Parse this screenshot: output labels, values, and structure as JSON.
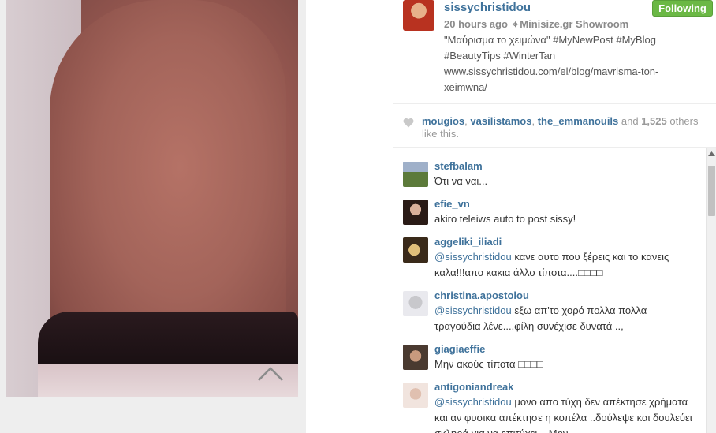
{
  "post": {
    "username": "sissychristidou",
    "follow_label": "Following",
    "time_ago": "20 hours ago",
    "location": "Minisize.gr Showroom",
    "caption_lines": [
      "\"Μαύρισμα το χειμώνα\" #MyNewPost #MyBlog",
      "#BeautyTips #WinterTan",
      "www.sissychristidou.com/el/blog/mavrisma-ton-",
      "xeimwna/"
    ],
    "colors": {
      "accent": "#3f729b",
      "follow_green": "#6bb845"
    }
  },
  "likes": {
    "user1": "mougios",
    "sep1": ", ",
    "user2": "vasilistamos",
    "sep2": ", ",
    "user3": "the_emmanouils",
    "and": " and ",
    "count": "1,525",
    "others": " others",
    "like_this": "like this."
  },
  "comments": [
    {
      "user": "stefbalam",
      "mention": "",
      "text": "Ότι να ναι..."
    },
    {
      "user": "efie_vn",
      "mention": "",
      "text": "akiro teleiws auto to post sissy!"
    },
    {
      "user": "aggeliki_iliadi",
      "mention": "@sissychristidou",
      "text": " κανε αυτο που ξέρεις και το κανεις καλα!!!απο κακια άλλο τίποτα....□□□□"
    },
    {
      "user": "christina.apostolou",
      "mention": "@sissychristidou",
      "text": " εξω απ'το χορό πολλα πολλα τραγούδια λένε....φίλη συνέχισε δυνατά ..,"
    },
    {
      "user": "giagiaeffie",
      "mention": "",
      "text": "Μην ακούς τίποτα □□□□"
    },
    {
      "user": "antigoniandreak",
      "mention": "@sissychristidou",
      "text": " μονο απο τύχη δεν απέκτησε χρήματα και αν φυσικα απέκτησε η κοπέλα ..δούλεψε και δουλεύει σκληρά για να επιτύχει .. Μην"
    }
  ]
}
